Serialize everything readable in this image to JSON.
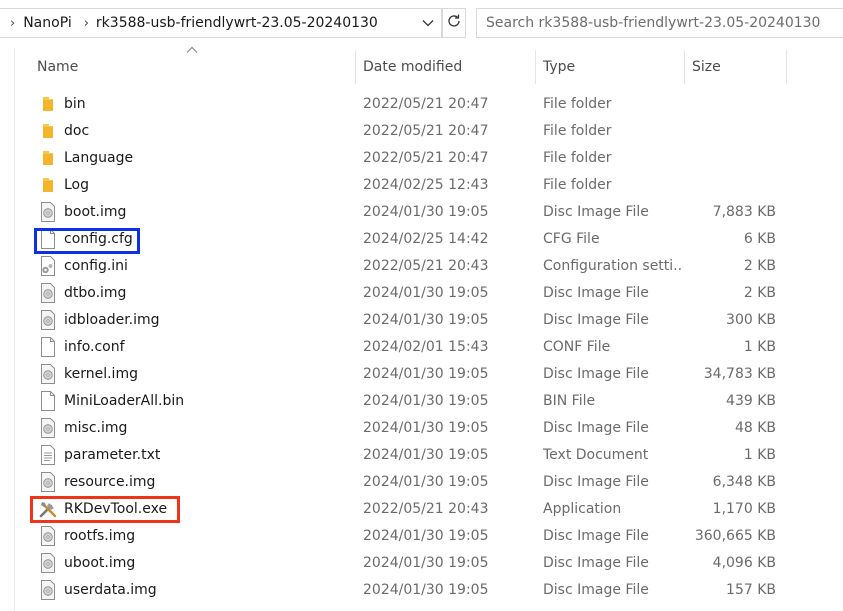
{
  "address": {
    "crumbs": [
      "NanoPi",
      "rk3588-usb-friendlywrt-23.05-20240130"
    ]
  },
  "search": {
    "placeholder": "Search rk3588-usb-friendlywrt-23.05-20240130"
  },
  "columns": {
    "name": "Name",
    "date": "Date modified",
    "type": "Type",
    "size": "Size"
  },
  "files": [
    {
      "name": "bin",
      "date": "2022/05/21 20:47",
      "type": "File folder",
      "size": "",
      "icon": "folder-icon"
    },
    {
      "name": "doc",
      "date": "2022/05/21 20:47",
      "type": "File folder",
      "size": "",
      "icon": "folder-icon"
    },
    {
      "name": "Language",
      "date": "2022/05/21 20:47",
      "type": "File folder",
      "size": "",
      "icon": "folder-icon"
    },
    {
      "name": "Log",
      "date": "2024/02/25 12:43",
      "type": "File folder",
      "size": "",
      "icon": "folder-icon"
    },
    {
      "name": "boot.img",
      "date": "2024/01/30 19:05",
      "type": "Disc Image File",
      "size": "7,883 KB",
      "icon": "disc-image-icon"
    },
    {
      "name": "config.cfg",
      "date": "2024/02/25 14:42",
      "type": "CFG File",
      "size": "6 KB",
      "icon": "blank-file-icon"
    },
    {
      "name": "config.ini",
      "date": "2022/05/21 20:43",
      "type": "Configuration setti...",
      "size": "2 KB",
      "icon": "settings-file-icon"
    },
    {
      "name": "dtbo.img",
      "date": "2024/01/30 19:05",
      "type": "Disc Image File",
      "size": "2 KB",
      "icon": "disc-image-icon"
    },
    {
      "name": "idbloader.img",
      "date": "2024/01/30 19:05",
      "type": "Disc Image File",
      "size": "300 KB",
      "icon": "disc-image-icon"
    },
    {
      "name": "info.conf",
      "date": "2024/02/01 15:43",
      "type": "CONF File",
      "size": "1 KB",
      "icon": "blank-file-icon"
    },
    {
      "name": "kernel.img",
      "date": "2024/01/30 19:05",
      "type": "Disc Image File",
      "size": "34,783 KB",
      "icon": "disc-image-icon"
    },
    {
      "name": "MiniLoaderAll.bin",
      "date": "2024/01/30 19:05",
      "type": "BIN File",
      "size": "439 KB",
      "icon": "blank-file-icon"
    },
    {
      "name": "misc.img",
      "date": "2024/01/30 19:05",
      "type": "Disc Image File",
      "size": "48 KB",
      "icon": "disc-image-icon"
    },
    {
      "name": "parameter.txt",
      "date": "2024/01/30 19:05",
      "type": "Text Document",
      "size": "1 KB",
      "icon": "text-file-icon"
    },
    {
      "name": "resource.img",
      "date": "2024/01/30 19:05",
      "type": "Disc Image File",
      "size": "6,348 KB",
      "icon": "disc-image-icon"
    },
    {
      "name": "RKDevTool.exe",
      "date": "2022/05/21 20:43",
      "type": "Application",
      "size": "1,170 KB",
      "icon": "tools-app-icon"
    },
    {
      "name": "rootfs.img",
      "date": "2024/01/30 19:05",
      "type": "Disc Image File",
      "size": "360,665 KB",
      "icon": "disc-image-icon"
    },
    {
      "name": "uboot.img",
      "date": "2024/01/30 19:05",
      "type": "Disc Image File",
      "size": "4,096 KB",
      "icon": "disc-image-icon"
    },
    {
      "name": "userdata.img",
      "date": "2024/01/30 19:05",
      "type": "Disc Image File",
      "size": "157 KB",
      "icon": "disc-image-icon"
    }
  ],
  "colors": {
    "highlight_blue": "#1030e8",
    "highlight_red": "#f0341a",
    "folder": "#f8c948"
  }
}
